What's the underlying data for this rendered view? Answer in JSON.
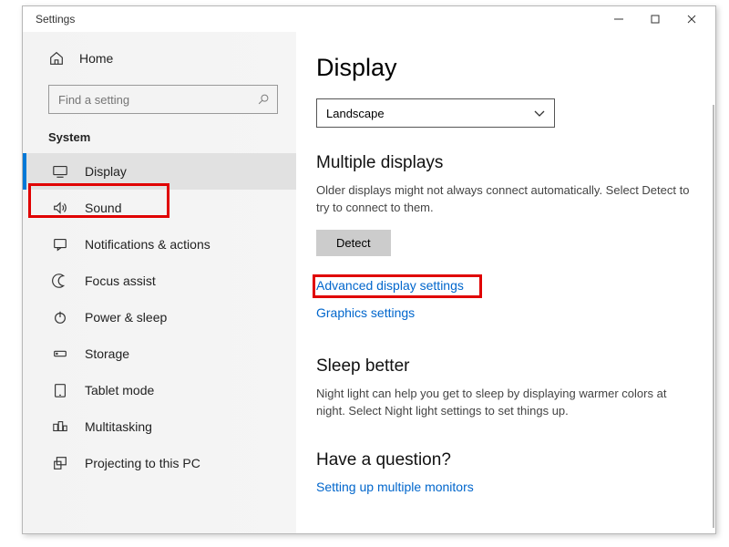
{
  "window": {
    "title": "Settings"
  },
  "sidebar": {
    "home": "Home",
    "search_placeholder": "Find a setting",
    "category": "System",
    "items": [
      {
        "label": "Display"
      },
      {
        "label": "Sound"
      },
      {
        "label": "Notifications & actions"
      },
      {
        "label": "Focus assist"
      },
      {
        "label": "Power & sleep"
      },
      {
        "label": "Storage"
      },
      {
        "label": "Tablet mode"
      },
      {
        "label": "Multitasking"
      },
      {
        "label": "Projecting to this PC"
      }
    ]
  },
  "main": {
    "title": "Display",
    "orientation_value": "Landscape",
    "multiple_displays": {
      "heading": "Multiple displays",
      "text": "Older displays might not always connect automatically. Select Detect to try to connect to them.",
      "detect_button": "Detect"
    },
    "link_advanced": "Advanced display settings",
    "link_graphics": "Graphics settings",
    "sleep_better": {
      "heading": "Sleep better",
      "text": "Night light can help you get to sleep by displaying warmer colors at night. Select Night light settings to set things up."
    },
    "question": {
      "heading": "Have a question?",
      "link": "Setting up multiple monitors"
    }
  }
}
